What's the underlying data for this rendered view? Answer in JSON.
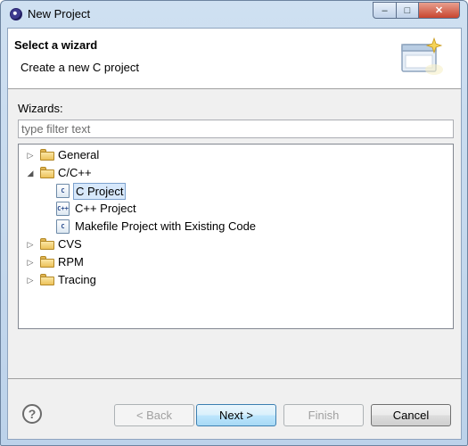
{
  "window": {
    "title": "New Project"
  },
  "header": {
    "title": "Select a wizard",
    "description": "Create a new C project"
  },
  "wizards": {
    "label": "Wizards:",
    "filter_placeholder": "type filter text",
    "tree": [
      {
        "label": "General",
        "type": "folder",
        "expanded": false
      },
      {
        "label": "C/C++",
        "type": "folder",
        "expanded": true,
        "children": [
          {
            "label": "C Project",
            "icon": "c-project-icon",
            "badge": "C",
            "selected": true
          },
          {
            "label": "C++ Project",
            "icon": "cpp-project-icon",
            "badge": "C++",
            "selected": false
          },
          {
            "label": "Makefile Project with Existing Code",
            "icon": "makefile-project-icon",
            "badge": "C",
            "selected": false
          }
        ]
      },
      {
        "label": "CVS",
        "type": "folder",
        "expanded": false
      },
      {
        "label": "RPM",
        "type": "folder",
        "expanded": false
      },
      {
        "label": "Tracing",
        "type": "folder",
        "expanded": false
      }
    ]
  },
  "buttons": {
    "help": "?",
    "back": "< Back",
    "next": "Next >",
    "finish": "Finish",
    "cancel": "Cancel"
  },
  "colors": {
    "selection": "#d7e8fb",
    "default_button_border": "#3c7fb1",
    "folder": "#ecc25a"
  }
}
